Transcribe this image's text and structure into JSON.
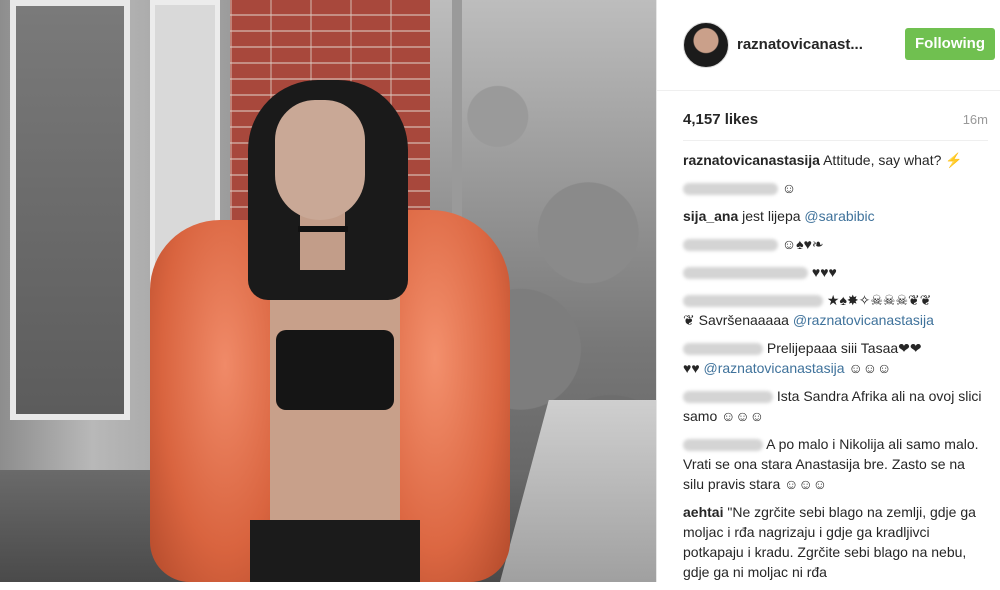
{
  "post": {
    "username": "raznatovicanast...",
    "follow_label": "Following",
    "likes": "4,157 likes",
    "time": "16m"
  },
  "comments": [
    {
      "user": "raznatovicanastasija",
      "text": "Attitude, say what? ⚡"
    },
    {
      "user": "",
      "text": "☺"
    },
    {
      "user": "sija_ana",
      "text": "jest lijepa",
      "mention": "@sarabibic"
    },
    {
      "user": "",
      "text": "☺♠♥❧"
    },
    {
      "user": "",
      "text": "♥♥♥"
    },
    {
      "user": "",
      "text": "★♠✸✧☠☠☠❦❦"
    },
    {
      "user": "",
      "text": "❦ Savršenaaaaa",
      "mention": "@raznatovicanastasija"
    },
    {
      "user": "",
      "text": "Prelijepaaa siii Tasaa❤❤"
    },
    {
      "user": "",
      "text": "♥♥",
      "mention": "@raznatovicanastasija",
      "after": "☺☺☺"
    },
    {
      "user": "",
      "text": "Ista Sandra Afrika ali na ovoj slici samo ☺☺☺"
    },
    {
      "user": "",
      "text": "A po malo i Nikolija ali samo malo. Vrati se ona stara Anastasija bre. Zasto se na silu pravis stara ☺☺☺"
    },
    {
      "user": "aehtai",
      "text": "\"Ne zgrčite sebi blago na zemlji, gdje ga moljac i rđa nagrizaju i gdje ga kradljivci potkapaju i kradu. Zgrčite sebi blago na nebu, gdje ga ni moljac ni rđa"
    }
  ]
}
